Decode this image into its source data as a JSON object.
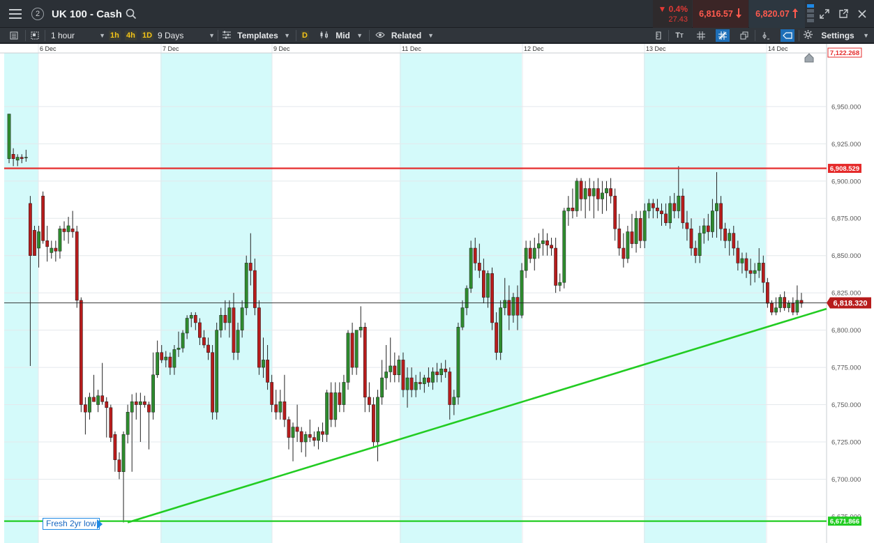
{
  "header": {
    "window_number": "2",
    "instrument": "UK 100 - Cash",
    "change_pct": "▼ 0.4%",
    "change_abs": "27.43",
    "sell_price": "6,816.57",
    "buy_price": "6,820.07"
  },
  "toolbar": {
    "interval": "1 hour",
    "quick_1h": "1h",
    "quick_4h": "4h",
    "quick_1d": "1D",
    "range": "9 Days",
    "templates": "Templates",
    "d_badge": "D",
    "price_type": "Mid",
    "related": "Related",
    "settings": "Settings"
  },
  "colors": {
    "up": "#2e8b2e",
    "down": "#b71c1c",
    "band": "#d4fafa",
    "resistance": "#e52b2b",
    "support": "#22cc22",
    "price_tag": "#b71c1c",
    "grid": "#e4e8ec"
  },
  "chart_data": {
    "type": "candlestick",
    "ylim": [
      6660,
      6985
    ],
    "y_ticks": [
      {
        "value": 6950,
        "label": "6,950.000"
      },
      {
        "value": 6925,
        "label": "6,925.000"
      },
      {
        "value": 6900,
        "label": "6,900.000"
      },
      {
        "value": 6875,
        "label": "6,875.000"
      },
      {
        "value": 6850,
        "label": "6,850.000"
      },
      {
        "value": 6825,
        "label": "6,825.000"
      },
      {
        "value": 6800,
        "label": "6,800.000"
      },
      {
        "value": 6775,
        "label": "6,775.000"
      },
      {
        "value": 6750,
        "label": "6,750.000"
      },
      {
        "value": 6725,
        "label": "6,725.000"
      },
      {
        "value": 6700,
        "label": "6,700.000"
      },
      {
        "value": 6675,
        "label": "6,675.000"
      }
    ],
    "top_label": "7,122.268",
    "date_labels": [
      "6 Dec",
      "7 Dec",
      "9 Dec",
      "11 Dec",
      "12 Dec",
      "13 Dec",
      "14 Dec"
    ],
    "horizontal_lines": [
      {
        "name": "resistance",
        "value": 6908.529,
        "label": "6,908.529"
      },
      {
        "name": "support",
        "value": 6671.866,
        "label": "6,671.866"
      }
    ],
    "current_price": {
      "value": 6818.32,
      "label": "6,818.320"
    },
    "trendline": {
      "from": {
        "bar": 28,
        "value": 6671
      },
      "to": {
        "bar": 196,
        "value": 6817
      }
    },
    "annotation": "Fresh 2yr low",
    "candles": [
      {
        "o": 6915,
        "h": 6945,
        "l": 6912,
        "c": 6945
      },
      {
        "o": 6918,
        "h": 6922,
        "l": 6910,
        "c": 6915
      },
      {
        "o": 6914,
        "h": 6918,
        "l": 6910,
        "c": 6916
      },
      {
        "o": 6916,
        "h": 6918,
        "l": 6912,
        "c": 6915
      },
      {
        "o": 6916,
        "h": 6921,
        "l": 6913,
        "c": 6916
      },
      {
        "o": 6885,
        "h": 6890,
        "l": 6776,
        "c": 6850
      },
      {
        "o": 6867,
        "h": 6870,
        "l": 6850,
        "c": 6850
      },
      {
        "o": 6855,
        "h": 6870,
        "l": 6842,
        "c": 6866
      },
      {
        "o": 6890,
        "h": 6893,
        "l": 6858,
        "c": 6860
      },
      {
        "o": 6860,
        "h": 6870,
        "l": 6846,
        "c": 6856
      },
      {
        "o": 6852,
        "h": 6860,
        "l": 6848,
        "c": 6855
      },
      {
        "o": 6855,
        "h": 6860,
        "l": 6846,
        "c": 6853
      },
      {
        "o": 6853,
        "h": 6870,
        "l": 6848,
        "c": 6868
      },
      {
        "o": 6868,
        "h": 6873,
        "l": 6860,
        "c": 6866
      },
      {
        "o": 6866,
        "h": 6876,
        "l": 6858,
        "c": 6870
      },
      {
        "o": 6868,
        "h": 6880,
        "l": 6862,
        "c": 6866
      },
      {
        "o": 6866,
        "h": 6870,
        "l": 6815,
        "c": 6820
      },
      {
        "o": 6820,
        "h": 6822,
        "l": 6745,
        "c": 6750
      },
      {
        "o": 6750,
        "h": 6755,
        "l": 6730,
        "c": 6745
      },
      {
        "o": 6745,
        "h": 6758,
        "l": 6740,
        "c": 6755
      },
      {
        "o": 6755,
        "h": 6770,
        "l": 6752,
        "c": 6752
      },
      {
        "o": 6750,
        "h": 6760,
        "l": 6745,
        "c": 6756
      },
      {
        "o": 6756,
        "h": 6778,
        "l": 6750,
        "c": 6752
      },
      {
        "o": 6752,
        "h": 6755,
        "l": 6728,
        "c": 6748
      },
      {
        "o": 6748,
        "h": 6750,
        "l": 6725,
        "c": 6728
      },
      {
        "o": 6730,
        "h": 6732,
        "l": 6705,
        "c": 6713
      },
      {
        "o": 6713,
        "h": 6718,
        "l": 6700,
        "c": 6705
      },
      {
        "o": 6705,
        "h": 6732,
        "l": 6671,
        "c": 6730
      },
      {
        "o": 6730,
        "h": 6750,
        "l": 6724,
        "c": 6745
      },
      {
        "o": 6745,
        "h": 6757,
        "l": 6705,
        "c": 6752
      },
      {
        "o": 6752,
        "h": 6758,
        "l": 6740,
        "c": 6750
      },
      {
        "o": 6750,
        "h": 6758,
        "l": 6725,
        "c": 6752
      },
      {
        "o": 6752,
        "h": 6756,
        "l": 6748,
        "c": 6750
      },
      {
        "o": 6750,
        "h": 6752,
        "l": 6720,
        "c": 6745
      },
      {
        "o": 6745,
        "h": 6785,
        "l": 6740,
        "c": 6770
      },
      {
        "o": 6770,
        "h": 6793,
        "l": 6768,
        "c": 6785
      },
      {
        "o": 6785,
        "h": 6790,
        "l": 6778,
        "c": 6780
      },
      {
        "o": 6780,
        "h": 6786,
        "l": 6775,
        "c": 6782
      },
      {
        "o": 6782,
        "h": 6785,
        "l": 6770,
        "c": 6775
      },
      {
        "o": 6775,
        "h": 6790,
        "l": 6770,
        "c": 6787
      },
      {
        "o": 6787,
        "h": 6799,
        "l": 6782,
        "c": 6788
      },
      {
        "o": 6788,
        "h": 6800,
        "l": 6785,
        "c": 6798
      },
      {
        "o": 6798,
        "h": 6810,
        "l": 6794,
        "c": 6808
      },
      {
        "o": 6808,
        "h": 6812,
        "l": 6802,
        "c": 6810
      },
      {
        "o": 6810,
        "h": 6812,
        "l": 6800,
        "c": 6805
      },
      {
        "o": 6805,
        "h": 6808,
        "l": 6790,
        "c": 6795
      },
      {
        "o": 6795,
        "h": 6800,
        "l": 6788,
        "c": 6790
      },
      {
        "o": 6790,
        "h": 6795,
        "l": 6780,
        "c": 6785
      },
      {
        "o": 6785,
        "h": 6790,
        "l": 6740,
        "c": 6745
      },
      {
        "o": 6745,
        "h": 6805,
        "l": 6740,
        "c": 6800
      },
      {
        "o": 6800,
        "h": 6815,
        "l": 6795,
        "c": 6810
      },
      {
        "o": 6810,
        "h": 6820,
        "l": 6800,
        "c": 6805
      },
      {
        "o": 6805,
        "h": 6820,
        "l": 6795,
        "c": 6815
      },
      {
        "o": 6815,
        "h": 6825,
        "l": 6780,
        "c": 6785
      },
      {
        "o": 6785,
        "h": 6805,
        "l": 6780,
        "c": 6800
      },
      {
        "o": 6800,
        "h": 6820,
        "l": 6795,
        "c": 6815
      },
      {
        "o": 6815,
        "h": 6850,
        "l": 6810,
        "c": 6845
      },
      {
        "o": 6845,
        "h": 6865,
        "l": 6830,
        "c": 6840
      },
      {
        "o": 6840,
        "h": 6848,
        "l": 6810,
        "c": 6815
      },
      {
        "o": 6815,
        "h": 6820,
        "l": 6770,
        "c": 6775
      },
      {
        "o": 6775,
        "h": 6795,
        "l": 6768,
        "c": 6780
      },
      {
        "o": 6780,
        "h": 6790,
        "l": 6760,
        "c": 6765
      },
      {
        "o": 6765,
        "h": 6770,
        "l": 6745,
        "c": 6750
      },
      {
        "o": 6750,
        "h": 6760,
        "l": 6740,
        "c": 6745
      },
      {
        "o": 6745,
        "h": 6760,
        "l": 6740,
        "c": 6752
      },
      {
        "o": 6752,
        "h": 6770,
        "l": 6735,
        "c": 6740
      },
      {
        "o": 6740,
        "h": 6742,
        "l": 6720,
        "c": 6728
      },
      {
        "o": 6728,
        "h": 6738,
        "l": 6712,
        "c": 6735
      },
      {
        "o": 6735,
        "h": 6750,
        "l": 6725,
        "c": 6732
      },
      {
        "o": 6732,
        "h": 6735,
        "l": 6718,
        "c": 6725
      },
      {
        "o": 6725,
        "h": 6732,
        "l": 6715,
        "c": 6730
      },
      {
        "o": 6730,
        "h": 6740,
        "l": 6725,
        "c": 6728
      },
      {
        "o": 6728,
        "h": 6732,
        "l": 6722,
        "c": 6726
      },
      {
        "o": 6726,
        "h": 6735,
        "l": 6720,
        "c": 6732
      },
      {
        "o": 6732,
        "h": 6738,
        "l": 6725,
        "c": 6730
      },
      {
        "o": 6730,
        "h": 6760,
        "l": 6725,
        "c": 6758
      },
      {
        "o": 6758,
        "h": 6765,
        "l": 6735,
        "c": 6740
      },
      {
        "o": 6740,
        "h": 6765,
        "l": 6735,
        "c": 6758
      },
      {
        "o": 6758,
        "h": 6765,
        "l": 6745,
        "c": 6750
      },
      {
        "o": 6750,
        "h": 6770,
        "l": 6745,
        "c": 6765
      },
      {
        "o": 6765,
        "h": 6800,
        "l": 6760,
        "c": 6798
      },
      {
        "o": 6798,
        "h": 6805,
        "l": 6770,
        "c": 6775
      },
      {
        "o": 6775,
        "h": 6800,
        "l": 6770,
        "c": 6800
      },
      {
        "o": 6800,
        "h": 6816,
        "l": 6795,
        "c": 6802
      },
      {
        "o": 6802,
        "h": 6805,
        "l": 6745,
        "c": 6755
      },
      {
        "o": 6755,
        "h": 6765,
        "l": 6745,
        "c": 6750
      },
      {
        "o": 6750,
        "h": 6755,
        "l": 6722,
        "c": 6725
      },
      {
        "o": 6725,
        "h": 6760,
        "l": 6712,
        "c": 6755
      },
      {
        "o": 6755,
        "h": 6780,
        "l": 6750,
        "c": 6768
      },
      {
        "o": 6768,
        "h": 6790,
        "l": 6760,
        "c": 6772
      },
      {
        "o": 6772,
        "h": 6795,
        "l": 6765,
        "c": 6776
      },
      {
        "o": 6776,
        "h": 6785,
        "l": 6765,
        "c": 6770
      },
      {
        "o": 6770,
        "h": 6783,
        "l": 6765,
        "c": 6780
      },
      {
        "o": 6780,
        "h": 6785,
        "l": 6755,
        "c": 6760
      },
      {
        "o": 6760,
        "h": 6775,
        "l": 6748,
        "c": 6768
      },
      {
        "o": 6768,
        "h": 6775,
        "l": 6755,
        "c": 6760
      },
      {
        "o": 6760,
        "h": 6770,
        "l": 6755,
        "c": 6765
      },
      {
        "o": 6765,
        "h": 6772,
        "l": 6760,
        "c": 6764
      },
      {
        "o": 6764,
        "h": 6770,
        "l": 6758,
        "c": 6768
      },
      {
        "o": 6768,
        "h": 6775,
        "l": 6762,
        "c": 6765
      },
      {
        "o": 6765,
        "h": 6775,
        "l": 6760,
        "c": 6772
      },
      {
        "o": 6772,
        "h": 6778,
        "l": 6765,
        "c": 6770
      },
      {
        "o": 6770,
        "h": 6778,
        "l": 6765,
        "c": 6774
      },
      {
        "o": 6774,
        "h": 6780,
        "l": 6768,
        "c": 6772
      },
      {
        "o": 6772,
        "h": 6775,
        "l": 6740,
        "c": 6750
      },
      {
        "o": 6750,
        "h": 6760,
        "l": 6743,
        "c": 6755
      },
      {
        "o": 6755,
        "h": 6805,
        "l": 6750,
        "c": 6802
      },
      {
        "o": 6802,
        "h": 6820,
        "l": 6800,
        "c": 6815
      },
      {
        "o": 6815,
        "h": 6830,
        "l": 6810,
        "c": 6828
      },
      {
        "o": 6828,
        "h": 6860,
        "l": 6825,
        "c": 6855
      },
      {
        "o": 6855,
        "h": 6862,
        "l": 6840,
        "c": 6845
      },
      {
        "o": 6845,
        "h": 6858,
        "l": 6835,
        "c": 6840
      },
      {
        "o": 6840,
        "h": 6848,
        "l": 6818,
        "c": 6822
      },
      {
        "o": 6822,
        "h": 6840,
        "l": 6815,
        "c": 6838
      },
      {
        "o": 6838,
        "h": 6842,
        "l": 6800,
        "c": 6805
      },
      {
        "o": 6805,
        "h": 6812,
        "l": 6780,
        "c": 6785
      },
      {
        "o": 6785,
        "h": 6820,
        "l": 6780,
        "c": 6815
      },
      {
        "o": 6815,
        "h": 6835,
        "l": 6810,
        "c": 6820
      },
      {
        "o": 6820,
        "h": 6830,
        "l": 6800,
        "c": 6810
      },
      {
        "o": 6810,
        "h": 6825,
        "l": 6805,
        "c": 6822
      },
      {
        "o": 6822,
        "h": 6830,
        "l": 6800,
        "c": 6810
      },
      {
        "o": 6810,
        "h": 6845,
        "l": 6808,
        "c": 6840
      },
      {
        "o": 6840,
        "h": 6860,
        "l": 6835,
        "c": 6855
      },
      {
        "o": 6855,
        "h": 6860,
        "l": 6845,
        "c": 6848
      },
      {
        "o": 6848,
        "h": 6862,
        "l": 6840,
        "c": 6855
      },
      {
        "o": 6855,
        "h": 6865,
        "l": 6848,
        "c": 6858
      },
      {
        "o": 6858,
        "h": 6868,
        "l": 6850,
        "c": 6860
      },
      {
        "o": 6860,
        "h": 6865,
        "l": 6850,
        "c": 6857
      },
      {
        "o": 6857,
        "h": 6862,
        "l": 6850,
        "c": 6855
      },
      {
        "o": 6855,
        "h": 6862,
        "l": 6825,
        "c": 6830
      },
      {
        "o": 6830,
        "h": 6838,
        "l": 6826,
        "c": 6832
      },
      {
        "o": 6832,
        "h": 6882,
        "l": 6828,
        "c": 6880
      },
      {
        "o": 6880,
        "h": 6890,
        "l": 6870,
        "c": 6882
      },
      {
        "o": 6882,
        "h": 6895,
        "l": 6875,
        "c": 6880
      },
      {
        "o": 6880,
        "h": 6902,
        "l": 6876,
        "c": 6900
      },
      {
        "o": 6900,
        "h": 6902,
        "l": 6880,
        "c": 6888
      },
      {
        "o": 6888,
        "h": 6900,
        "l": 6875,
        "c": 6895
      },
      {
        "o": 6895,
        "h": 6902,
        "l": 6880,
        "c": 6890
      },
      {
        "o": 6890,
        "h": 6900,
        "l": 6875,
        "c": 6895
      },
      {
        "o": 6895,
        "h": 6902,
        "l": 6880,
        "c": 6888
      },
      {
        "o": 6888,
        "h": 6900,
        "l": 6878,
        "c": 6892
      },
      {
        "o": 6892,
        "h": 6900,
        "l": 6880,
        "c": 6895
      },
      {
        "o": 6895,
        "h": 6902,
        "l": 6885,
        "c": 6890
      },
      {
        "o": 6890,
        "h": 6895,
        "l": 6860,
        "c": 6868
      },
      {
        "o": 6868,
        "h": 6878,
        "l": 6850,
        "c": 6855
      },
      {
        "o": 6855,
        "h": 6865,
        "l": 6842,
        "c": 6848
      },
      {
        "o": 6848,
        "h": 6870,
        "l": 6845,
        "c": 6866
      },
      {
        "o": 6866,
        "h": 6878,
        "l": 6855,
        "c": 6858
      },
      {
        "o": 6858,
        "h": 6880,
        "l": 6852,
        "c": 6875
      },
      {
        "o": 6875,
        "h": 6880,
        "l": 6855,
        "c": 6860
      },
      {
        "o": 6860,
        "h": 6885,
        "l": 6855,
        "c": 6880
      },
      {
        "o": 6880,
        "h": 6888,
        "l": 6875,
        "c": 6885
      },
      {
        "o": 6885,
        "h": 6888,
        "l": 6875,
        "c": 6882
      },
      {
        "o": 6882,
        "h": 6888,
        "l": 6875,
        "c": 6880
      },
      {
        "o": 6880,
        "h": 6885,
        "l": 6870,
        "c": 6878
      },
      {
        "o": 6878,
        "h": 6885,
        "l": 6870,
        "c": 6872
      },
      {
        "o": 6872,
        "h": 6890,
        "l": 6868,
        "c": 6885
      },
      {
        "o": 6885,
        "h": 6892,
        "l": 6875,
        "c": 6880
      },
      {
        "o": 6880,
        "h": 6910,
        "l": 6875,
        "c": 6890
      },
      {
        "o": 6890,
        "h": 6895,
        "l": 6868,
        "c": 6872
      },
      {
        "o": 6872,
        "h": 6880,
        "l": 6860,
        "c": 6868
      },
      {
        "o": 6868,
        "h": 6875,
        "l": 6850,
        "c": 6855
      },
      {
        "o": 6855,
        "h": 6860,
        "l": 6845,
        "c": 6850
      },
      {
        "o": 6850,
        "h": 6870,
        "l": 6845,
        "c": 6865
      },
      {
        "o": 6865,
        "h": 6875,
        "l": 6858,
        "c": 6870
      },
      {
        "o": 6870,
        "h": 6878,
        "l": 6860,
        "c": 6866
      },
      {
        "o": 6866,
        "h": 6888,
        "l": 6862,
        "c": 6880
      },
      {
        "o": 6880,
        "h": 6906,
        "l": 6862,
        "c": 6885
      },
      {
        "o": 6885,
        "h": 6890,
        "l": 6860,
        "c": 6868
      },
      {
        "o": 6868,
        "h": 6872,
        "l": 6855,
        "c": 6860
      },
      {
        "o": 6860,
        "h": 6868,
        "l": 6850,
        "c": 6865
      },
      {
        "o": 6865,
        "h": 6870,
        "l": 6850,
        "c": 6855
      },
      {
        "o": 6855,
        "h": 6860,
        "l": 6840,
        "c": 6845
      },
      {
        "o": 6845,
        "h": 6852,
        "l": 6838,
        "c": 6848
      },
      {
        "o": 6848,
        "h": 6852,
        "l": 6835,
        "c": 6840
      },
      {
        "o": 6840,
        "h": 6848,
        "l": 6830,
        "c": 6838
      },
      {
        "o": 6838,
        "h": 6845,
        "l": 6832,
        "c": 6840
      },
      {
        "o": 6840,
        "h": 6855,
        "l": 6835,
        "c": 6845
      },
      {
        "o": 6845,
        "h": 6850,
        "l": 6825,
        "c": 6832
      },
      {
        "o": 6832,
        "h": 6835,
        "l": 6815,
        "c": 6818
      },
      {
        "o": 6818,
        "h": 6820,
        "l": 6810,
        "c": 6812
      },
      {
        "o": 6812,
        "h": 6822,
        "l": 6810,
        "c": 6815
      },
      {
        "o": 6815,
        "h": 6824,
        "l": 6812,
        "c": 6822
      },
      {
        "o": 6822,
        "h": 6826,
        "l": 6813,
        "c": 6815
      },
      {
        "o": 6815,
        "h": 6820,
        "l": 6812,
        "c": 6818
      },
      {
        "o": 6818,
        "h": 6822,
        "l": 6810,
        "c": 6812
      },
      {
        "o": 6812,
        "h": 6830,
        "l": 6810,
        "c": 6820
      },
      {
        "o": 6820,
        "h": 6825,
        "l": 6815,
        "c": 6818
      }
    ]
  }
}
